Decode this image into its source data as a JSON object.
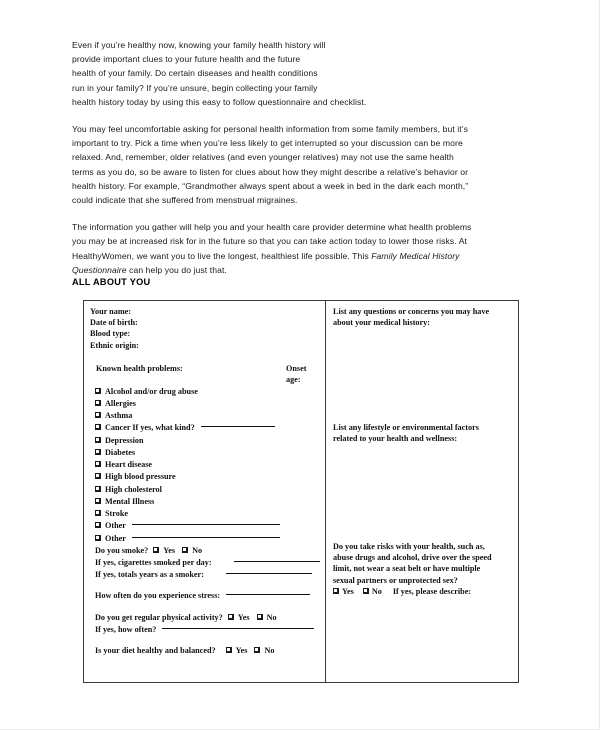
{
  "document": {
    "intro_paragraphs": [
      {
        "id": "p1",
        "lines": [
          "Even if you’re healthy now, knowing your family health history will",
          "provide important clues to your future health and the future",
          "health of your family. Do certain diseases and health conditions",
          "run in your family? If you’re unsure, begin collecting your family",
          "health history today by using this easy to follow questionnaire and checklist."
        ]
      },
      {
        "id": "p2",
        "lines": [
          "You may feel uncomfortable asking for personal health information from some family members, but it’s",
          "important to try. Pick a time when you’re less likely to get interrupted so your discussion can be more",
          "relaxed. And, remember, older relatives (and even younger relatives) may not use the same health",
          "terms as you do, so be aware to listen for clues about how they might describe a relative’s behavior or",
          "health history. For example, “Grandmother always spent about a week in bed in the dark each month,”",
          "could indicate that she suffered from menstrual migraines."
        ]
      },
      {
        "id": "p3",
        "line1": "The information you gather will help you and your health care provider determine what health problems",
        "line2": "you may be at increased risk for in the future so that you can take action today to lower those risks. At",
        "line3_pre": "HealthyWomen, we want you to live the longest, healthiest life possible. This ",
        "line3_italic": "Family Medical History",
        "line4_italic": "Questionnaire",
        "line4_post": " can help you do just that."
      }
    ],
    "section_heading": "ALL ABOUT YOU"
  },
  "form": {
    "left_column": {
      "identity_fields": [
        "Your name:",
        "Date of birth:",
        "Blood type:",
        "Ethnic origin:"
      ],
      "known_problems_label": "Known health problems:",
      "onset_label_line1": "Onset",
      "onset_label_line2": "age:",
      "checkbox_items": [
        {
          "label": "Alcohol and/or drug abuse",
          "rule": "none"
        },
        {
          "label": "Allergies",
          "rule": "none"
        },
        {
          "label": "Asthma",
          "rule": "none"
        },
        {
          "label": "Cancer If yes, what kind?",
          "rule": "cancer"
        },
        {
          "label": "Depression",
          "rule": "none"
        },
        {
          "label": "Diabetes",
          "rule": "none"
        },
        {
          "label": "Heart disease",
          "rule": "none"
        },
        {
          "label": "High blood pressure",
          "rule": "none"
        },
        {
          "label": "High cholesterol",
          "rule": "none"
        },
        {
          "label": "Mental Illness",
          "rule": "none"
        },
        {
          "label": "Stroke",
          "rule": "none"
        },
        {
          "label": "Other",
          "rule": "other"
        },
        {
          "label": "Other",
          "rule": "other"
        }
      ],
      "smoke_question": "Do you smoke?",
      "smoke_yes": "Yes",
      "smoke_no": "No",
      "cigarettes_per_day": "If yes, cigarettes smoked per day:",
      "total_years_smoker": "If yes, totals years as a smoker:",
      "stress_question": "How often do you experience stress:",
      "activity_question": "Do you get regular physical activity?",
      "activity_yes": "Yes",
      "activity_no": "No",
      "activity_howoften": "If yes, how often?",
      "diet_question": "Is your diet healthy and balanced?",
      "diet_yes": "Yes",
      "diet_no": "No"
    },
    "right_column": {
      "block1_line1": "List any questions or concerns you may have",
      "block1_line2": "about your medical history:",
      "block2_line1": "List any lifestyle or environmental factors",
      "block2_line2": "related to your health and wellness:",
      "block3_line1": "Do you take risks with your health, such as,",
      "block3_line2": "abuse drugs and alcohol, drive over the speed",
      "block3_line3": "limit, not wear a seat belt or have multiple",
      "block3_line4": "sexual partners or unprotected sex?",
      "block3_yes": "Yes",
      "block3_no": "No",
      "block3_describe": "If yes, please describe:"
    }
  },
  "colors": {
    "page_background": "#ffffff",
    "text": "#1a1a1a",
    "table_border": "#3a3a3a",
    "rule_line": "#111111"
  }
}
